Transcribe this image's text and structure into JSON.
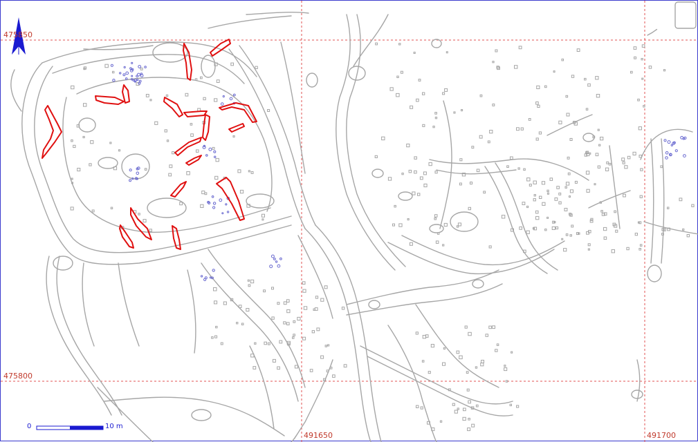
{
  "map": {
    "grid_labels": {
      "northing_top": "475850",
      "northing_bottom": "475800",
      "easting_middle": "491650",
      "easting_right": "491700"
    },
    "scale_bar": {
      "start_label": "0",
      "end_label": "10 m"
    },
    "north_arrow": "north-arrow-icon",
    "colors": {
      "grid": "#e05050",
      "features": "#a6a6a6",
      "highlighted_features": "#e01010",
      "finds": "#6a6ad0",
      "scale_bar": "#1a1ad0"
    }
  }
}
